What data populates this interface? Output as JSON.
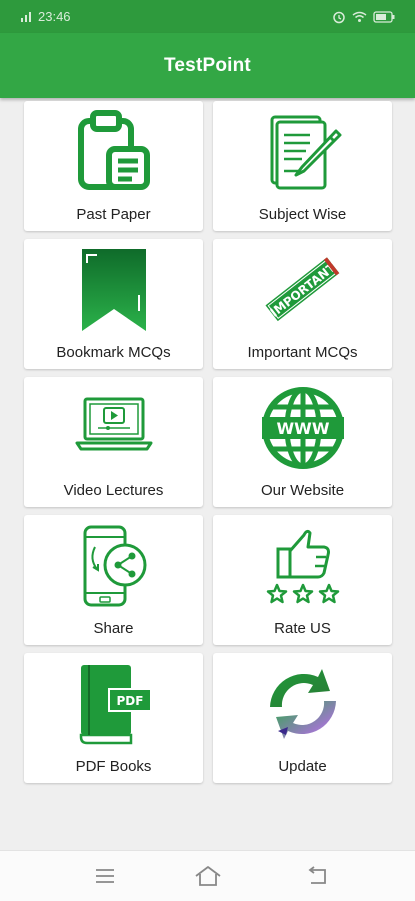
{
  "status_bar": {
    "time": "23:46",
    "icons": [
      "signal-icon",
      "alarm-icon",
      "wifi-icon",
      "battery-icon"
    ]
  },
  "app_bar": {
    "title": "TestPoint"
  },
  "menu": [
    {
      "label": "Past Paper",
      "icon": "clipboard-icon"
    },
    {
      "label": "Subject Wise",
      "icon": "document-pen-icon"
    },
    {
      "label": "Bookmark MCQs",
      "icon": "bookmark-icon"
    },
    {
      "label": "Important MCQs",
      "icon": "important-stamp-icon"
    },
    {
      "label": "Video Lectures",
      "icon": "laptop-video-icon"
    },
    {
      "label": "Our Website",
      "icon": "www-globe-icon"
    },
    {
      "label": "Share",
      "icon": "phone-share-icon"
    },
    {
      "label": "Rate US",
      "icon": "thumbs-up-stars-icon"
    },
    {
      "label": "PDF Books",
      "icon": "pdf-book-icon"
    },
    {
      "label": "Update",
      "icon": "sync-arrows-icon"
    }
  ],
  "colors": {
    "primary": "#33a745",
    "status_bar": "#2e9a3d",
    "icon_green": "#1f9a3a"
  },
  "nav_bar": [
    "menu-icon",
    "home-icon",
    "back-icon"
  ]
}
